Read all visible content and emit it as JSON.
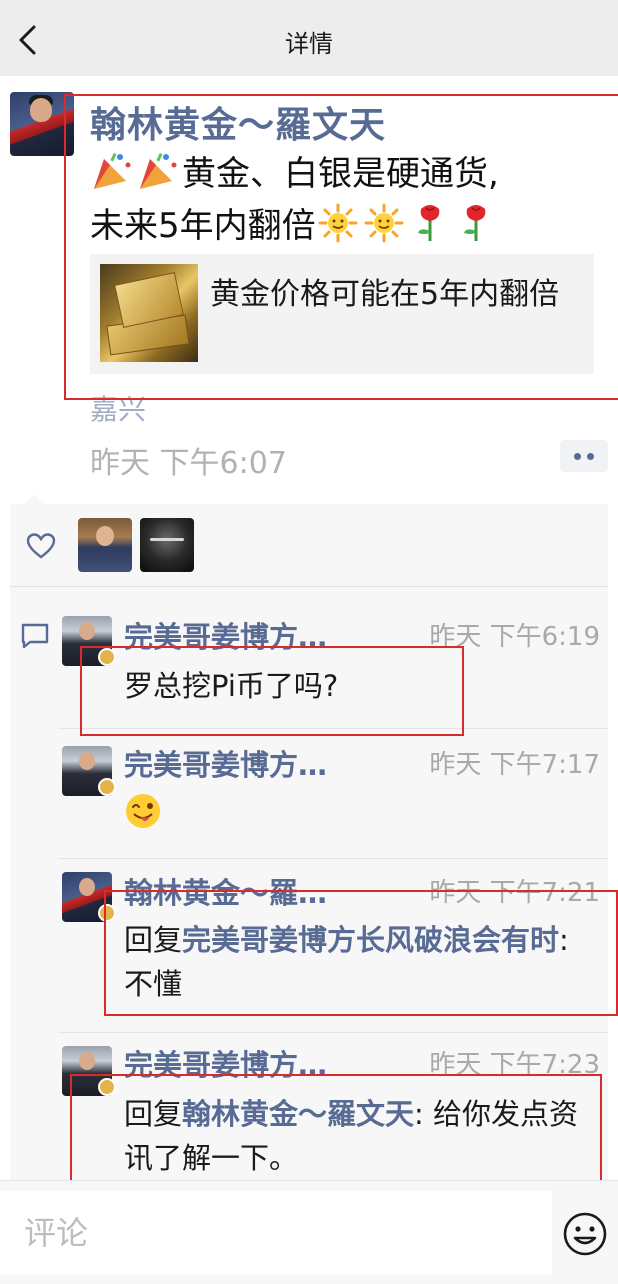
{
  "header": {
    "title": "详情"
  },
  "post": {
    "author": "翰林黄金～羅文天",
    "text_line1": "黄金、白银是硬通货,",
    "text_line2": "未来5年内翻倍",
    "link_card": {
      "title": "黄金价格可能在5年内翻倍"
    },
    "location": "嘉兴",
    "time": "昨天 下午6:07"
  },
  "comments": [
    {
      "author": "完美哥姜博方…",
      "time": "昨天 下午6:19",
      "text": "罗总挖Pi币了吗?"
    },
    {
      "author": "完美哥姜博方…",
      "time": "昨天 下午7:17",
      "text": ""
    },
    {
      "author": "翰林黄金～羅…",
      "time": "昨天 下午7:21",
      "reply_prefix": "回复",
      "reply_to": "完美哥姜博方长风破浪会有时",
      "text": ": 不懂"
    },
    {
      "author": "完美哥姜博方…",
      "time": "昨天 下午7:23",
      "reply_prefix": "回复",
      "reply_to": "翰林黄金～羅文天",
      "text": ": 给你发点资讯了解一下。"
    }
  ],
  "footer": {
    "placeholder": "评论"
  },
  "colors": {
    "link_blue": "#576b95",
    "annotation_red": "#d92b2b",
    "header_bg": "#ededed",
    "panel_bg": "#f7f7f7"
  }
}
